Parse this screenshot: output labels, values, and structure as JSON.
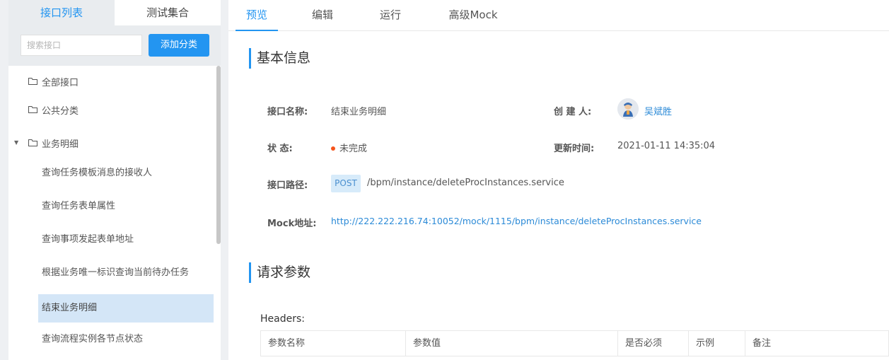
{
  "left_panel": {
    "tabs": [
      {
        "label": "接口列表",
        "active": true
      },
      {
        "label": "测试集合",
        "active": false
      }
    ],
    "search": {
      "placeholder": "搜索接口"
    },
    "add_button_label": "添加分类",
    "folders": [
      {
        "label": "全部接口",
        "expanded": false
      },
      {
        "label": "公共分类",
        "expanded": false
      },
      {
        "label": "业务明细",
        "expanded": true
      }
    ],
    "sub_items": [
      {
        "label": "查询任务模板消息的接收人",
        "selected": false
      },
      {
        "label": "查询任务表单属性",
        "selected": false
      },
      {
        "label": "查询事项发起表单地址",
        "selected": false
      },
      {
        "label": "根据业务唯一标识查询当前待办任务",
        "selected": false
      },
      {
        "label": "结束业务明细",
        "selected": true
      },
      {
        "label": "查询流程实例各节点状态",
        "selected": false
      }
    ]
  },
  "top_tabs": [
    {
      "label": "预览",
      "active": true
    },
    {
      "label": "编辑",
      "active": false
    },
    {
      "label": "运行",
      "active": false
    },
    {
      "label": "高级Mock",
      "active": false
    }
  ],
  "basic_info": {
    "title": "基本信息",
    "name_label": "接口名称:",
    "name_value": "结束业务明细",
    "creator_label": "创 建 人:",
    "creator_value": "吴斌胜",
    "status_label": "状 态:",
    "status_value": "未完成",
    "status_color": "#f5541c",
    "updated_label": "更新时间:",
    "updated_value": "2021-01-11 14:35:04",
    "path_label": "接口路径:",
    "method": "POST",
    "path_value": "/bpm/instance/deleteProcInstances.service",
    "mock_label": "Mock地址:",
    "mock_value": "http://222.222.216.74:10052/mock/1115/bpm/instance/deleteProcInstances.service"
  },
  "request_params": {
    "title": "请求参数",
    "headers_label": "Headers:",
    "columns": [
      "参数名称",
      "参数值",
      "是否必须",
      "示例",
      "备注"
    ]
  },
  "colors": {
    "accent": "#2395f1",
    "selected_bg": "#d4e6f7",
    "link": "#2b8ad7"
  }
}
